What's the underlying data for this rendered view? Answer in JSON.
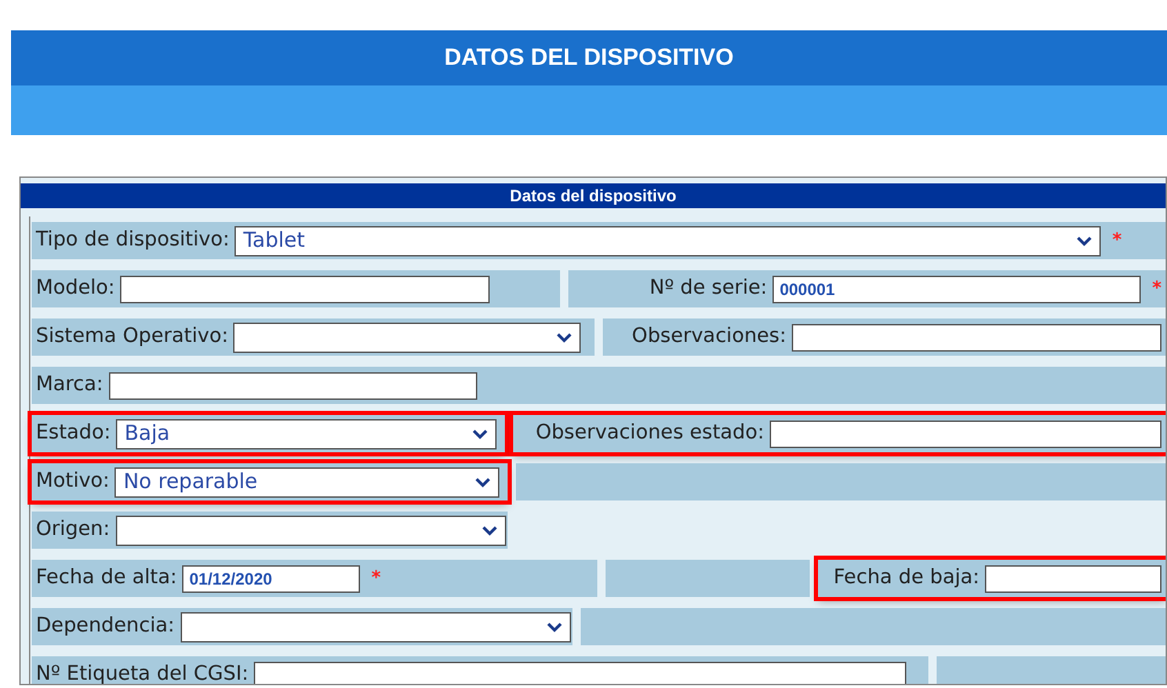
{
  "page_title": "DATOS DEL DISPOSITIVO",
  "panel": {
    "title": "Datos del dispositivo",
    "rows": [
      {
        "cells": [
          {
            "kind": "select",
            "label": "Tipo de dispositivo:",
            "value": "Tablet",
            "required_mark": "*",
            "highlighted": false
          }
        ]
      },
      {
        "cells": [
          {
            "kind": "input",
            "label": "Modelo:",
            "highlighted": false
          },
          {
            "kind": "input",
            "label": "Nº de serie:",
            "value": "000001",
            "required_mark": "*",
            "highlighted": false
          }
        ]
      },
      {
        "cells": [
          {
            "kind": "select",
            "label": "Sistema Operativo:",
            "highlighted": false
          },
          {
            "kind": "input",
            "label": "Observaciones:",
            "highlighted": false
          }
        ]
      },
      {
        "cells": [
          {
            "kind": "input",
            "label": "Marca:",
            "highlighted": false
          }
        ]
      },
      {
        "cells": [
          {
            "kind": "select",
            "label": "Estado:",
            "value": "Baja",
            "highlighted": true
          },
          {
            "kind": "input",
            "label": "Observaciones estado:",
            "highlighted": true
          }
        ]
      },
      {
        "cells": [
          {
            "kind": "select",
            "label": "Motivo:",
            "value": "No reparable",
            "highlighted": true
          },
          {
            "kind": "empty"
          }
        ]
      },
      {
        "cells": [
          {
            "kind": "select",
            "label": "Origen:",
            "highlighted": false
          }
        ]
      },
      {
        "cells": [
          {
            "kind": "input",
            "label": "Fecha de alta:",
            "value": "01/12/2020",
            "required_mark": "*",
            "highlighted": false
          },
          {
            "kind": "empty"
          },
          {
            "kind": "input",
            "label": "Fecha de baja:",
            "highlighted": true
          }
        ]
      },
      {
        "cells": [
          {
            "kind": "select",
            "label": "Dependencia:",
            "highlighted": false
          },
          {
            "kind": "empty"
          }
        ]
      },
      {
        "cells": [
          {
            "kind": "input",
            "label": "Nº Etiqueta del CGSI:",
            "highlighted": false
          },
          {
            "kind": "empty"
          }
        ]
      }
    ]
  }
}
